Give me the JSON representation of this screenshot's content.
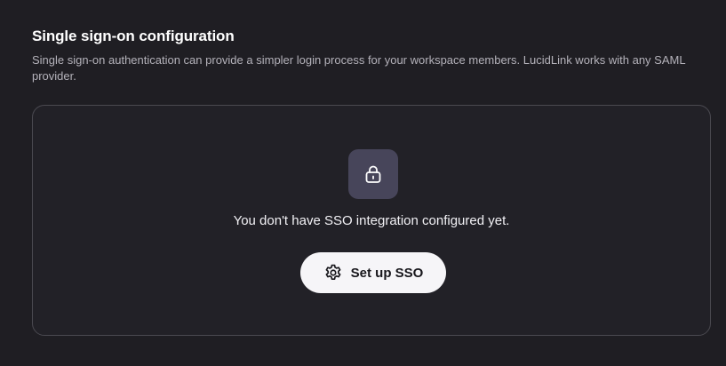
{
  "section": {
    "title": "Single sign-on configuration",
    "description": "Single sign-on authentication can provide a simpler login process for your workspace members. LucidLink works with any SAML provider."
  },
  "empty_state": {
    "icon": "lock-icon",
    "message": "You don't have SSO integration configured yet.",
    "button_icon": "gear-icon",
    "button_label": "Set up SSO"
  },
  "colors": {
    "background": "#1f1e23",
    "card_border": "#4a4950",
    "icon_tile": "#47455a",
    "button_bg": "#f6f5f8"
  }
}
